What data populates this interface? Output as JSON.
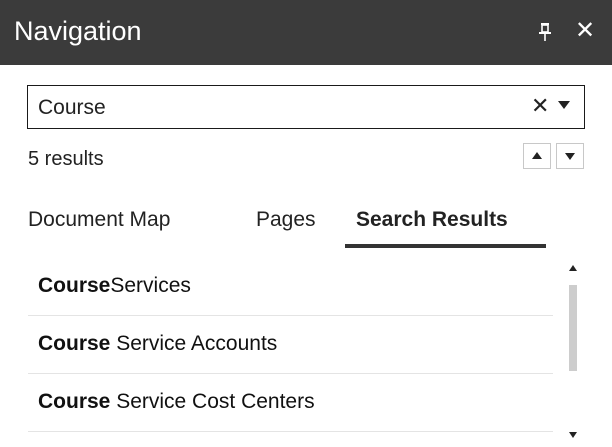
{
  "panel": {
    "title": "Navigation",
    "pin_icon": "pin-icon",
    "close_icon": "close-icon",
    "close_glyph": "✕"
  },
  "search": {
    "value": "Course",
    "clear_glyph": "✕",
    "clear_icon": "clear-icon",
    "dropdown_icon": "chevron-down-icon"
  },
  "results_info": {
    "count_text": "5 results",
    "prev_icon": "arrow-up-icon",
    "next_icon": "arrow-down-icon"
  },
  "tabs": [
    {
      "label": "Document Map",
      "active": false
    },
    {
      "label": "Pages",
      "active": false
    },
    {
      "label": "Search Results",
      "active": true
    }
  ],
  "results": [
    {
      "match": "Course",
      "rest": "Services"
    },
    {
      "match": "Course",
      "rest": " Service Accounts"
    },
    {
      "match": "Course",
      "rest": " Service Cost Centers"
    }
  ],
  "colors": {
    "titlebar_bg": "#3b3b3b",
    "titlebar_text": "#ffffff",
    "active_tab_underline": "#333333"
  }
}
